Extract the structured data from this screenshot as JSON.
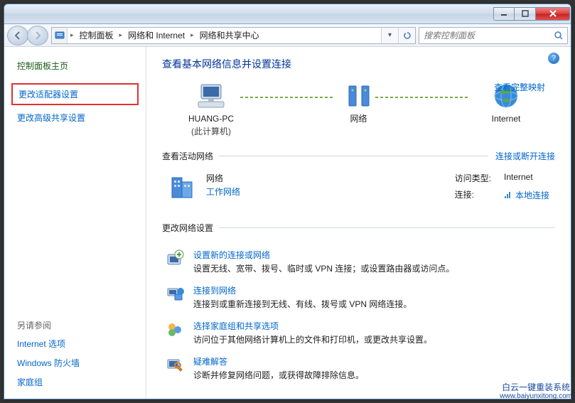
{
  "breadcrumb": {
    "seg1": "控制面板",
    "seg2": "网络和 Internet",
    "seg3": "网络和共享中心"
  },
  "search": {
    "placeholder": "搜索控制面板"
  },
  "sidebar": {
    "home": "控制面板主页",
    "adapter": "更改适配器设置",
    "adv_share": "更改高级共享设置",
    "see_also": "另请参阅",
    "inet_opts": "Internet 选项",
    "firewall": "Windows 防火墙",
    "homegroup": "家庭组"
  },
  "main": {
    "title": "查看基本网络信息并设置连接",
    "map_link": "查看完整映射",
    "pc_name": "HUANG-PC",
    "pc_sub": "(此计算机)",
    "net_label": "网络",
    "internet_label": "Internet",
    "sect_active": "查看活动网络",
    "active_rlink": "连接或断开连接",
    "an_name": "网络",
    "an_type": "工作网络",
    "an_access_lbl": "访问类型:",
    "an_access_val": "Internet",
    "an_conn_lbl": "连接:",
    "an_conn_val": "本地连接",
    "sect_change": "更改网络设置",
    "tasks": [
      {
        "title": "设置新的连接或网络",
        "desc": "设置无线、宽带、拨号、临时或 VPN 连接；或设置路由器或访问点。"
      },
      {
        "title": "连接到网络",
        "desc": "连接到或重新连接到无线、有线、拨号或 VPN 网络连接。"
      },
      {
        "title": "选择家庭组和共享选项",
        "desc": "访问位于其他网络计算机上的文件和打印机，或更改共享设置。"
      },
      {
        "title": "疑难解答",
        "desc": "诊断并修复网络问题，或获得故障排除信息。"
      }
    ]
  },
  "watermark": {
    "line1": "白云一键重装系统",
    "line2": "www.baiyunxitong.com"
  }
}
